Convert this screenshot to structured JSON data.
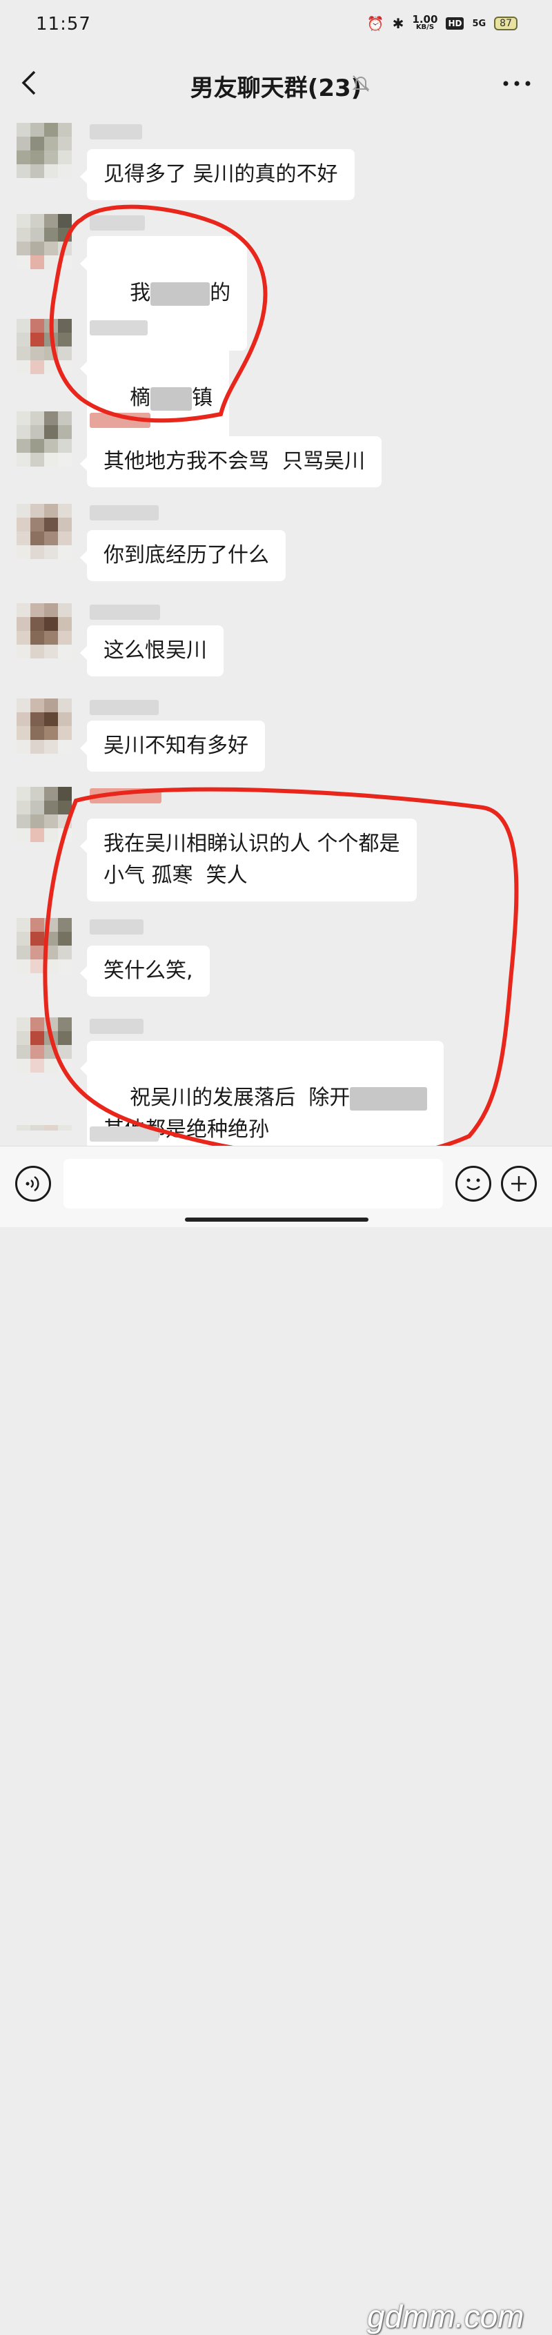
{
  "status_bar": {
    "time": "11:57",
    "net_speed_value": "1.00",
    "net_speed_unit": "KB/S",
    "hd": "HD",
    "network": "5G",
    "battery": "87"
  },
  "header": {
    "title": "男友聊天群(23)"
  },
  "messages": [
    {
      "text": "见得多了 吴川的真的不好"
    },
    {
      "text_before": "我",
      "text_after": "的"
    },
    {
      "text_before": "樀",
      "text_after": "镇"
    },
    {
      "text": "其他地方我不会骂  只骂吴川"
    },
    {
      "text": "你到底经历了什么"
    },
    {
      "text": "这么恨吴川"
    },
    {
      "text": "吴川不知有多好"
    },
    {
      "text": "我在吴川相睇认识的人 个个都是\n小气 孤寒  笑人"
    },
    {
      "text": "笑什么笑,"
    },
    {
      "line1": "祝吴川的发展落后  除开",
      "line2": "其他都是绝种绝孙"
    }
  ],
  "watermark": "gdmm.com",
  "colors": {
    "background": "#ededed",
    "bubble": "#ffffff",
    "annotation_circle": "#e8261b"
  },
  "icons": [
    "back-arrow-icon",
    "mute-bell-icon",
    "more-dots-icon",
    "voice-icon",
    "emoji-icon",
    "add-icon"
  ]
}
